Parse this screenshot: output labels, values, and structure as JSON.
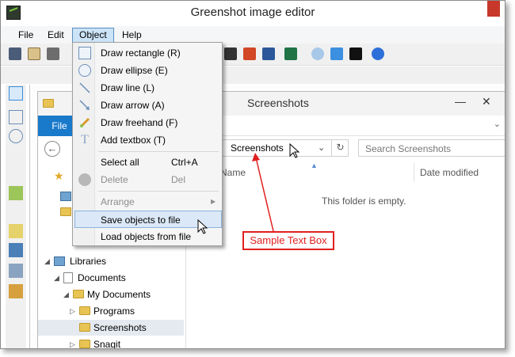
{
  "window": {
    "title": "Greenshot image editor"
  },
  "menubar": {
    "items": [
      "File",
      "Edit",
      "Object",
      "Help"
    ]
  },
  "object_menu": {
    "items": [
      {
        "label": "Draw rectangle (R)",
        "shortcut": "",
        "icon": "rectangle-icon",
        "disabled": false
      },
      {
        "label": "Draw ellipse (E)",
        "shortcut": "",
        "icon": "ellipse-icon",
        "disabled": false
      },
      {
        "label": "Draw line (L)",
        "shortcut": "",
        "icon": "line-icon",
        "disabled": false
      },
      {
        "label": "Draw arrow (A)",
        "shortcut": "",
        "icon": "arrow-icon",
        "disabled": false
      },
      {
        "label": "Draw freehand (F)",
        "shortcut": "",
        "icon": "freehand-icon",
        "disabled": false
      },
      {
        "label": "Add textbox (T)",
        "shortcut": "",
        "icon": "textbox-icon",
        "disabled": false
      },
      {
        "label": "Select all",
        "shortcut": "Ctrl+A",
        "icon": "",
        "disabled": false
      },
      {
        "label": "Delete",
        "shortcut": "Del",
        "icon": "delete-icon",
        "disabled": true
      },
      {
        "label": "Arrange",
        "shortcut": "",
        "icon": "",
        "disabled": true,
        "submenu": true
      },
      {
        "label": "Save objects to file",
        "shortcut": "",
        "icon": "",
        "disabled": false,
        "highlighted": true
      },
      {
        "label": "Load objects from file",
        "shortcut": "",
        "icon": "",
        "disabled": false
      }
    ]
  },
  "explorer": {
    "title": "Screenshots",
    "ribbon_file": "File",
    "address": "Screenshots",
    "search_placeholder": "Search Screenshots",
    "columns": {
      "name": "Name",
      "date": "Date modified"
    },
    "empty_message": "This folder is empty.",
    "tree": [
      {
        "label": "Libraries"
      },
      {
        "label": "Documents"
      },
      {
        "label": "My Documents"
      },
      {
        "label": "Programs"
      },
      {
        "label": "Screenshots"
      },
      {
        "label": "Snagit"
      }
    ]
  },
  "annotation": {
    "text": "Sample Text Box",
    "color": "#e02020"
  },
  "colors": {
    "menu_highlight": "#dbe8f7",
    "file_tab": "#1979ca",
    "accent_red": "#e02020"
  }
}
